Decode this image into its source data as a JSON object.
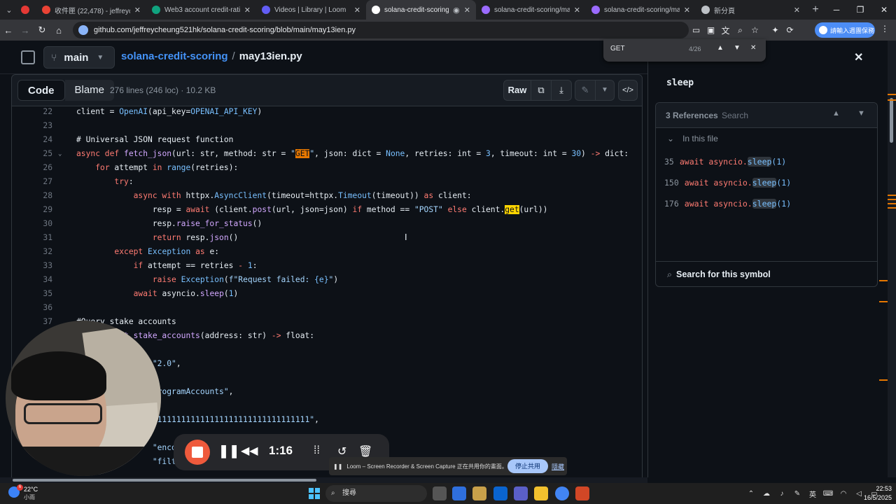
{
  "browser": {
    "tabs": [
      {
        "label": "",
        "favicon_color": "#e53935"
      },
      {
        "label": "收件匣 (22,478) - jeffreycheung",
        "favicon_color": "#ea4335"
      },
      {
        "label": "Web3 account credit-rating",
        "favicon_color": "#10a37f"
      },
      {
        "label": "Videos | Library | Loom",
        "favicon_color": "#625df5"
      },
      {
        "label": "solana-credit-scoring/m",
        "favicon_color": "#ffffff",
        "active": true
      },
      {
        "label": "solana-credit-scoring/may1",
        "favicon_color": "#9b6bff"
      },
      {
        "label": "solana-credit-scoring/may1",
        "favicon_color": "#9b6bff"
      },
      {
        "label": "新分頁",
        "favicon_color": "#bdc1c6"
      }
    ],
    "new_tab": "+",
    "url": "github.com/jeffreycheung521hk/solana-credit-scoring/blob/main/may13ien.py",
    "profile_label": "請輸入週團保務"
  },
  "find_bar": {
    "query": "GET",
    "count": "4/26"
  },
  "github": {
    "branch": "main",
    "repo": "solana-credit-scoring",
    "separator": "/",
    "file": "may13ien.py",
    "tabs": {
      "code": "Code",
      "blame": "Blame"
    },
    "file_info": "276 lines (246 loc) · 10.2 KB",
    "raw_label": "Raw"
  },
  "symbols_panel": {
    "symbol": "sleep",
    "ref_count": "3 References",
    "search_placeholder": "Search",
    "section": "In this file",
    "references": [
      {
        "line": "35",
        "code_before": "await asyncio.",
        "symbol": "sleep",
        "code_after": "(1)"
      },
      {
        "line": "150",
        "code_before": "await asyncio.",
        "symbol": "sleep",
        "code_after": "(1)"
      },
      {
        "line": "176",
        "code_before": "await asyncio.",
        "symbol": "sleep",
        "code_after": "(1)"
      }
    ],
    "footer": "Search for this symbol"
  },
  "code_lines": [
    {
      "n": "22"
    },
    {
      "n": "23"
    },
    {
      "n": "24"
    },
    {
      "n": "25"
    },
    {
      "n": "26"
    },
    {
      "n": "27"
    },
    {
      "n": "28"
    },
    {
      "n": "29"
    },
    {
      "n": "30"
    },
    {
      "n": "31"
    },
    {
      "n": "32"
    },
    {
      "n": "33"
    },
    {
      "n": "34"
    },
    {
      "n": "35"
    },
    {
      "n": "36"
    },
    {
      "n": "37"
    },
    {
      "n": ""
    },
    {
      "n": ""
    },
    {
      "n": ""
    },
    {
      "n": ""
    },
    {
      "n": ""
    },
    {
      "n": ""
    },
    {
      "n": ""
    },
    {
      "n": ""
    },
    {
      "n": ""
    }
  ],
  "loom": {
    "time": "1:16"
  },
  "share_banner": {
    "text": "Loom – Screen Recorder & Screen Capture 正在共用你的畫面。",
    "stop_label": "停止共用",
    "hide_label": "隱藏"
  },
  "taskbar": {
    "temp": "22°C",
    "condition": "小雨",
    "badge": "6",
    "search_label": "搜尋",
    "time": "22:53",
    "date": "16/5/2025",
    "ime": "英"
  },
  "colors": {
    "accent_link": "#4493f8",
    "find_current": "#e67700",
    "find_match": "#ffd500",
    "loom_stop": "#ef5a3c"
  }
}
